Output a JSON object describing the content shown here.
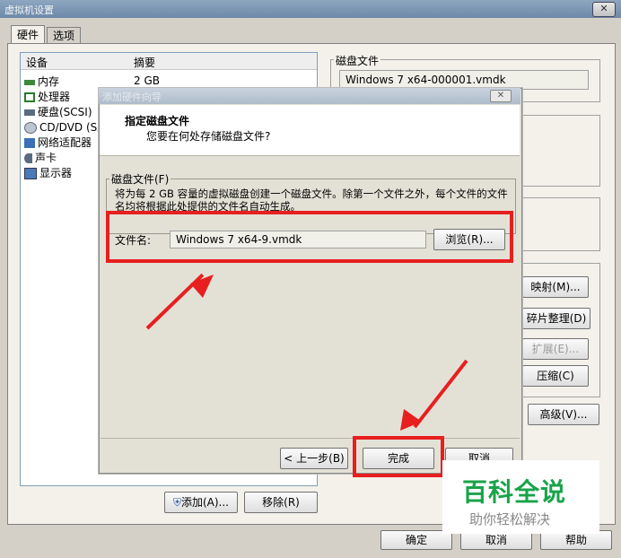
{
  "window": {
    "title": "虚拟机设置"
  },
  "tabs": [
    {
      "label": "硬件"
    },
    {
      "label": "选项"
    }
  ],
  "device_list": {
    "headers": {
      "device": "设备",
      "summary": "摘要"
    },
    "items": [
      {
        "label": "内存",
        "icon": "memory-icon",
        "summary": "2 GB"
      },
      {
        "label": "处理器",
        "icon": "processor-icon"
      },
      {
        "label": "硬盘(SCSI)",
        "icon": "hard-disk-icon"
      },
      {
        "label": "CD/DVD (SA",
        "icon": "cd-dvd-icon"
      },
      {
        "label": "网络适配器",
        "icon": "network-adapter-icon"
      },
      {
        "label": "声卡",
        "icon": "sound-card-icon"
      },
      {
        "label": "显示器",
        "icon": "display-icon"
      }
    ],
    "add_button": "添加(A)...",
    "remove_button": "移除(R)"
  },
  "disk_file_group": {
    "label": "磁盘文件",
    "value": "Windows 7 x64-000001.vmdk"
  },
  "utilities": {
    "map": "映射(M)...",
    "defrag": "碎片整理(D)",
    "expand": "扩展(E)...",
    "compact": "压缩(C)",
    "advanced": "高级(V)..."
  },
  "dialog": {
    "title": "添加硬件向导",
    "heading": "指定磁盘文件",
    "subheading": "您要在何处存储磁盘文件?",
    "group_label": "磁盘文件(F)",
    "description_line1": "将为每 2 GB 容量的虚拟磁盘创建一个磁盘文件。除第一个文件之外，每个文件的文件",
    "description_line2": "名均将根据此处提供的文件名自动生成。",
    "filename_label": "文件名:",
    "filename_value": "Windows 7 x64-9.vmdk",
    "browse_button": "浏览(R)...",
    "back_button": "< 上一步(B)",
    "finish_button": "完成",
    "cancel_button": "取消"
  },
  "footer": {
    "ok": "确定",
    "cancel": "取消",
    "help": "帮助"
  },
  "watermark": {
    "title": "百科全说",
    "subtitle": "助你轻松解决"
  },
  "colors": {
    "highlight": "#e81f1f",
    "watermark_green": "#1aa34a"
  }
}
